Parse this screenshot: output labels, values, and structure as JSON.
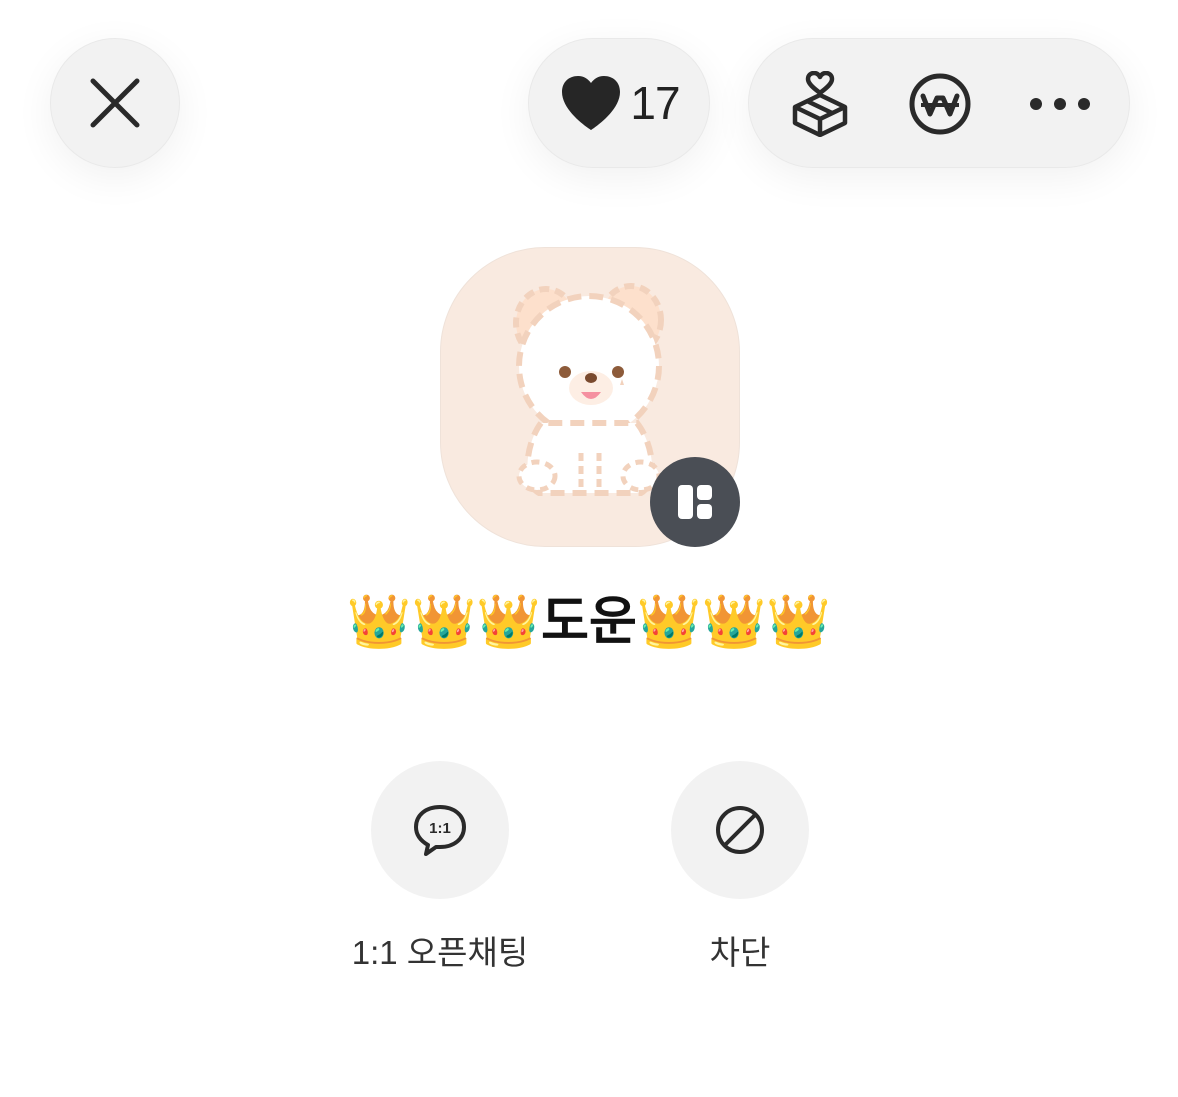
{
  "header": {
    "close_icon": "close-icon",
    "like": {
      "icon": "heart-icon",
      "count": "17"
    },
    "actions": [
      {
        "icon": "gift-box-heart-icon"
      },
      {
        "icon": "won-coin-icon"
      },
      {
        "icon": "more-horizontal-icon"
      }
    ]
  },
  "profile": {
    "avatar": "avatar",
    "badge_icon": "profile-switch-icon",
    "nickname": "👑👑👑도운👑👑👑"
  },
  "buttons": {
    "openchat": {
      "icon": "chat-1to1-icon",
      "icon_text": "1:1",
      "label": "1:1 오픈채팅"
    },
    "block": {
      "icon": "block-icon",
      "label": "차단"
    }
  },
  "colors": {
    "pill_bg": "#f2f2f2",
    "avatar_bg": "#f9eae0",
    "badge_bg": "#4a4e55",
    "text_dark": "#222222"
  }
}
